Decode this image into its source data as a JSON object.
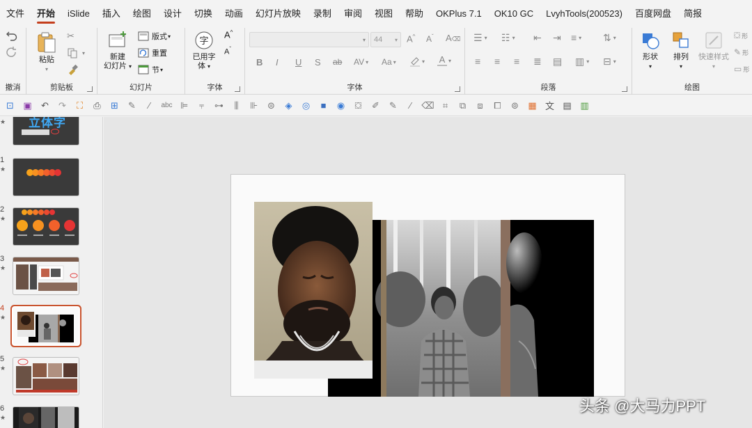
{
  "menu": {
    "tabs": [
      "文件",
      "开始",
      "iSlide",
      "插入",
      "绘图",
      "设计",
      "切换",
      "动画",
      "幻灯片放映",
      "录制",
      "审阅",
      "视图",
      "帮助",
      "OKPlus 7.1",
      "OK10 GC",
      "LvyhTools(200523)",
      "百度网盘",
      "简报"
    ],
    "active_index": 1
  },
  "ribbon": {
    "undo": {
      "label": "撤消"
    },
    "clipboard": {
      "label": "剪贴板",
      "paste": "粘贴"
    },
    "slides": {
      "label": "幻灯片",
      "new_slide_line1": "新建",
      "new_slide_line2": "幻灯片",
      "layout": "版式",
      "reset": "重置",
      "section": "节"
    },
    "fonts": {
      "label": "字体",
      "used_fonts_line1": "已用字",
      "used_fonts_line2": "体"
    },
    "font": {
      "label": "字体",
      "font_name": "",
      "font_size": "44"
    },
    "paragraph": {
      "label": "段落"
    },
    "drawing": {
      "label": "绘图",
      "shapes": "形状",
      "arrange": "排列",
      "quick_styles": "快速样式"
    }
  },
  "thumbnails": {
    "items": [
      {
        "num": "",
        "caption": "立体字"
      },
      {
        "num": "1"
      },
      {
        "num": "2"
      },
      {
        "num": "3"
      },
      {
        "num": "4",
        "selected": true
      },
      {
        "num": "5"
      },
      {
        "num": "6"
      }
    ]
  },
  "watermark": "头条 @大马力PPT",
  "colors": {
    "accent": "#c43e1c",
    "selection": "#c9542f"
  }
}
